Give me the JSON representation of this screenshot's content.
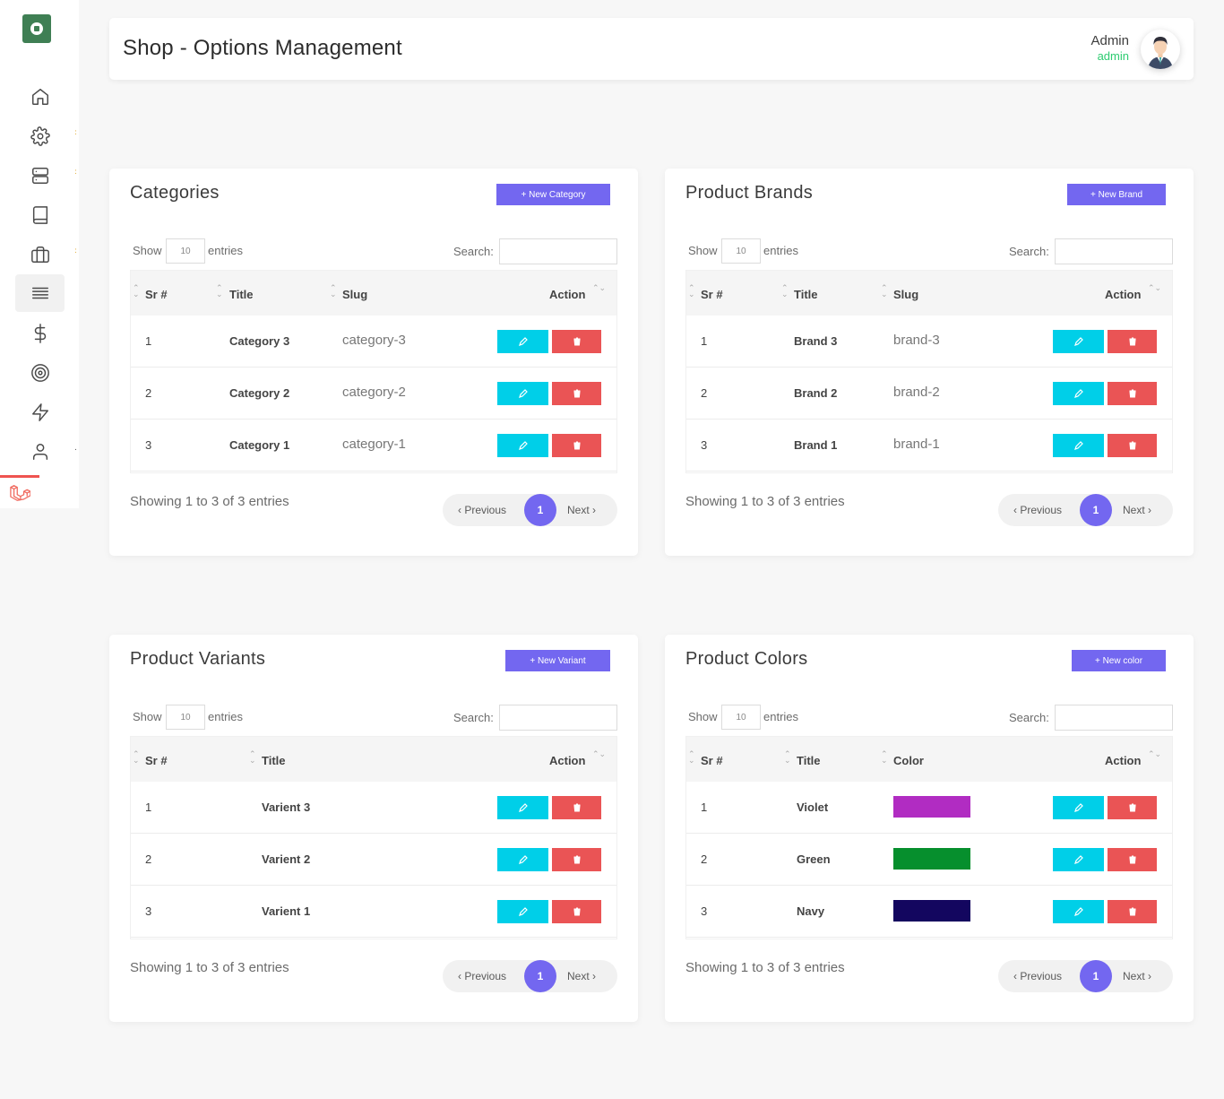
{
  "app": {
    "page_title": "Shop - Options Management",
    "user_name": "Admin",
    "user_role": "admin"
  },
  "sidebar": {
    "items": [
      {
        "icon": "home-icon"
      },
      {
        "icon": "gear-icon"
      },
      {
        "icon": "server-icon"
      },
      {
        "icon": "book-icon"
      },
      {
        "icon": "briefcase-icon"
      },
      {
        "icon": "list-icon",
        "active": true
      },
      {
        "icon": "dollar-icon"
      },
      {
        "icon": "target-icon"
      },
      {
        "icon": "zap-icon"
      },
      {
        "icon": "user-icon"
      }
    ]
  },
  "common": {
    "show": "Show",
    "length": "10",
    "entries": "entries",
    "search": "Search:",
    "info": "Showing 1 to 3 of 3 entries",
    "prev": "‹ Previous",
    "page": "1",
    "next": "Next ›",
    "col_sr": "Sr #",
    "col_title": "Title",
    "col_action": "Action"
  },
  "categories": {
    "title": "Categories",
    "new_label": "+ New Category",
    "col_slug": "Slug",
    "rows": [
      {
        "sr": "1",
        "title": "Category 3",
        "slug": "category-3"
      },
      {
        "sr": "2",
        "title": "Category 2",
        "slug": "category-2"
      },
      {
        "sr": "3",
        "title": "Category 1",
        "slug": "category-1"
      }
    ]
  },
  "brands": {
    "title": "Product Brands",
    "new_label": "+ New Brand",
    "col_slug": "Slug",
    "rows": [
      {
        "sr": "1",
        "title": "Brand 3",
        "slug": "brand-3"
      },
      {
        "sr": "2",
        "title": "Brand 2",
        "slug": "brand-2"
      },
      {
        "sr": "3",
        "title": "Brand 1",
        "slug": "brand-1"
      }
    ]
  },
  "variants": {
    "title": "Product Variants",
    "new_label": "+ New Variant",
    "rows": [
      {
        "sr": "1",
        "title": "Varient 3"
      },
      {
        "sr": "2",
        "title": "Varient 2"
      },
      {
        "sr": "3",
        "title": "Varient 1"
      }
    ]
  },
  "colors": {
    "title": "Product Colors",
    "new_label": "+ New color",
    "col_color": "Color",
    "rows": [
      {
        "sr": "1",
        "title": "Violet",
        "color": "#b12cc2"
      },
      {
        "sr": "2",
        "title": "Green",
        "color": "#068f2d"
      },
      {
        "sr": "3",
        "title": "Navy",
        "color": "#13065f"
      }
    ]
  },
  "colors_theme": {
    "accent": "#7367f0",
    "edit": "#00cfe8",
    "delete": "#ea5455",
    "online": "#2ecc71"
  }
}
